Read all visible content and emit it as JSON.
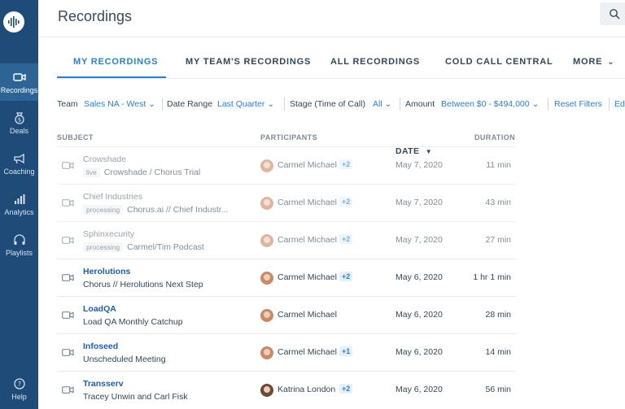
{
  "sidebar": {
    "items": [
      {
        "label": "Recordings",
        "icon": "video-camera-icon"
      },
      {
        "label": "Deals",
        "icon": "money-bag-icon"
      },
      {
        "label": "Coaching",
        "icon": "megaphone-icon"
      },
      {
        "label": "Analytics",
        "icon": "bar-chart-icon"
      },
      {
        "label": "Playlists",
        "icon": "headphones-icon"
      }
    ],
    "help_label": "Help"
  },
  "header": {
    "title": "Recordings"
  },
  "tabs": [
    {
      "label": "MY RECORDINGS",
      "active": true
    },
    {
      "label": "MY TEAM'S RECORDINGS"
    },
    {
      "label": "ALL RECORDINGS"
    },
    {
      "label": "COLD CALL CENTRAL"
    },
    {
      "label": "MORE"
    }
  ],
  "filters": {
    "team_label": "Team",
    "team_value": "Sales NA - West",
    "date_label": "Date Range",
    "date_value": "Last Quarter",
    "stage_label": "Stage (Time of Call)",
    "stage_value": "All",
    "amount_label": "Amount",
    "amount_value": "Between $0 - $494,000",
    "reset_label": "Reset Filters",
    "edit_label": "Ed"
  },
  "table": {
    "columns": {
      "subject": "SUBJECT",
      "participants": "PARTICIPANTS",
      "date": "DATE",
      "duration": "DURATION"
    },
    "rows": [
      {
        "title": "Crowshade",
        "badge": "live",
        "subtitle": "Crowshade / Chorus Trial",
        "participant": "Carmel Michael",
        "plus": "+2",
        "date": "May 7, 2020",
        "duration": "11 min"
      },
      {
        "title": "Chief Industries",
        "badge": "processing",
        "subtitle": "Chorus.ai // Chief Industr...",
        "participant": "Carmel Michael",
        "plus": "+2",
        "date": "May 7, 2020",
        "duration": "43 min"
      },
      {
        "title": "Sphinxecurity",
        "badge": "processing",
        "subtitle": "Carmel/Tim Podcast",
        "participant": "Carmel Michael",
        "plus": "+2",
        "date": "May 7, 2020",
        "duration": "27 min"
      },
      {
        "title": "Herolutions",
        "badge": "",
        "subtitle": "Chorus // Herolutions Next Step",
        "participant": "Carmel Michael",
        "plus": "+2",
        "date": "May 6, 2020",
        "duration": "1 hr 1 min"
      },
      {
        "title": "LoadQA",
        "badge": "",
        "subtitle": "Load QA Monthly Catchup",
        "participant": "Carmel Michael",
        "plus": "",
        "date": "May 6, 2020",
        "duration": "28 min"
      },
      {
        "title": "Infoseed",
        "badge": "",
        "subtitle": "Unscheduled Meeting",
        "participant": "Carmel Michael",
        "plus": "+1",
        "date": "May 6, 2020",
        "duration": "14 min"
      },
      {
        "title": "Transserv",
        "badge": "",
        "subtitle": "Tracey Unwin and Carl Fisk",
        "participant": "Katrina London",
        "plus": "+2",
        "date": "May 6, 2020",
        "duration": "56 min"
      }
    ]
  },
  "colors": {
    "sidebar": "#1f4b78",
    "accent": "#2a7fd4",
    "link": "#1f5fa8"
  }
}
